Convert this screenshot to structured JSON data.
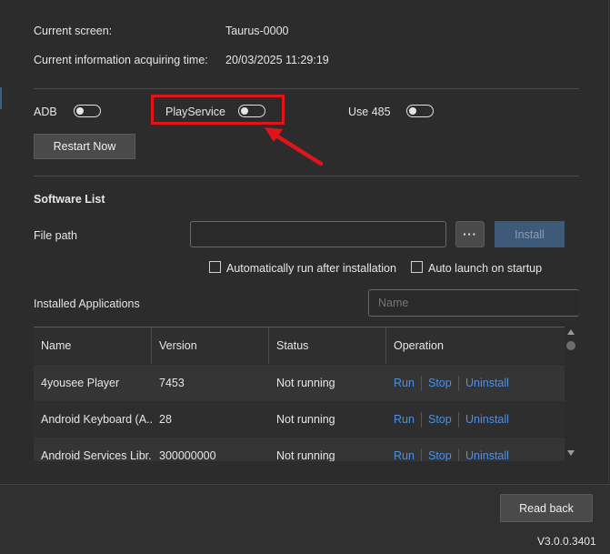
{
  "info": {
    "current_screen_label": "Current screen:",
    "current_screen_value": "Taurus-0000",
    "acquire_time_label": "Current information acquiring time:",
    "acquire_time_value": "20/03/2025 11:29:19"
  },
  "toggles": {
    "adb_label": "ADB",
    "adb_on": false,
    "playservice_label": "PlayService",
    "playservice_on": false,
    "use485_label": "Use 485",
    "use485_on": false
  },
  "restart_label": "Restart Now",
  "software": {
    "section_title": "Software List",
    "file_path_label": "File path",
    "file_path_value": "",
    "browse_label": "···",
    "install_label": "Install",
    "auto_run_label": "Automatically run after installation",
    "auto_run_checked": false,
    "auto_launch_label": "Auto launch on startup",
    "auto_launch_checked": false
  },
  "installed": {
    "title": "Installed Applications",
    "search_placeholder": "Name"
  },
  "table": {
    "columns": [
      "Name",
      "Version",
      "Status",
      "Operation"
    ],
    "rows": [
      {
        "name": "4yousee Player",
        "version": "7453",
        "status": "Not running"
      },
      {
        "name": "Android Keyboard (A...",
        "version": "28",
        "status": "Not running"
      },
      {
        "name": "Android Services Libr...",
        "version": "300000000",
        "status": "Not running"
      }
    ],
    "ops": {
      "run": "Run",
      "stop": "Stop",
      "uninstall": "Uninstall"
    }
  },
  "footer": {
    "read_back_label": "Read back",
    "version": "V3.0.0.3401"
  },
  "colors": {
    "accent_link": "#4f8fe0",
    "highlight": "#e0141a",
    "install_button": "#3d5a78"
  }
}
